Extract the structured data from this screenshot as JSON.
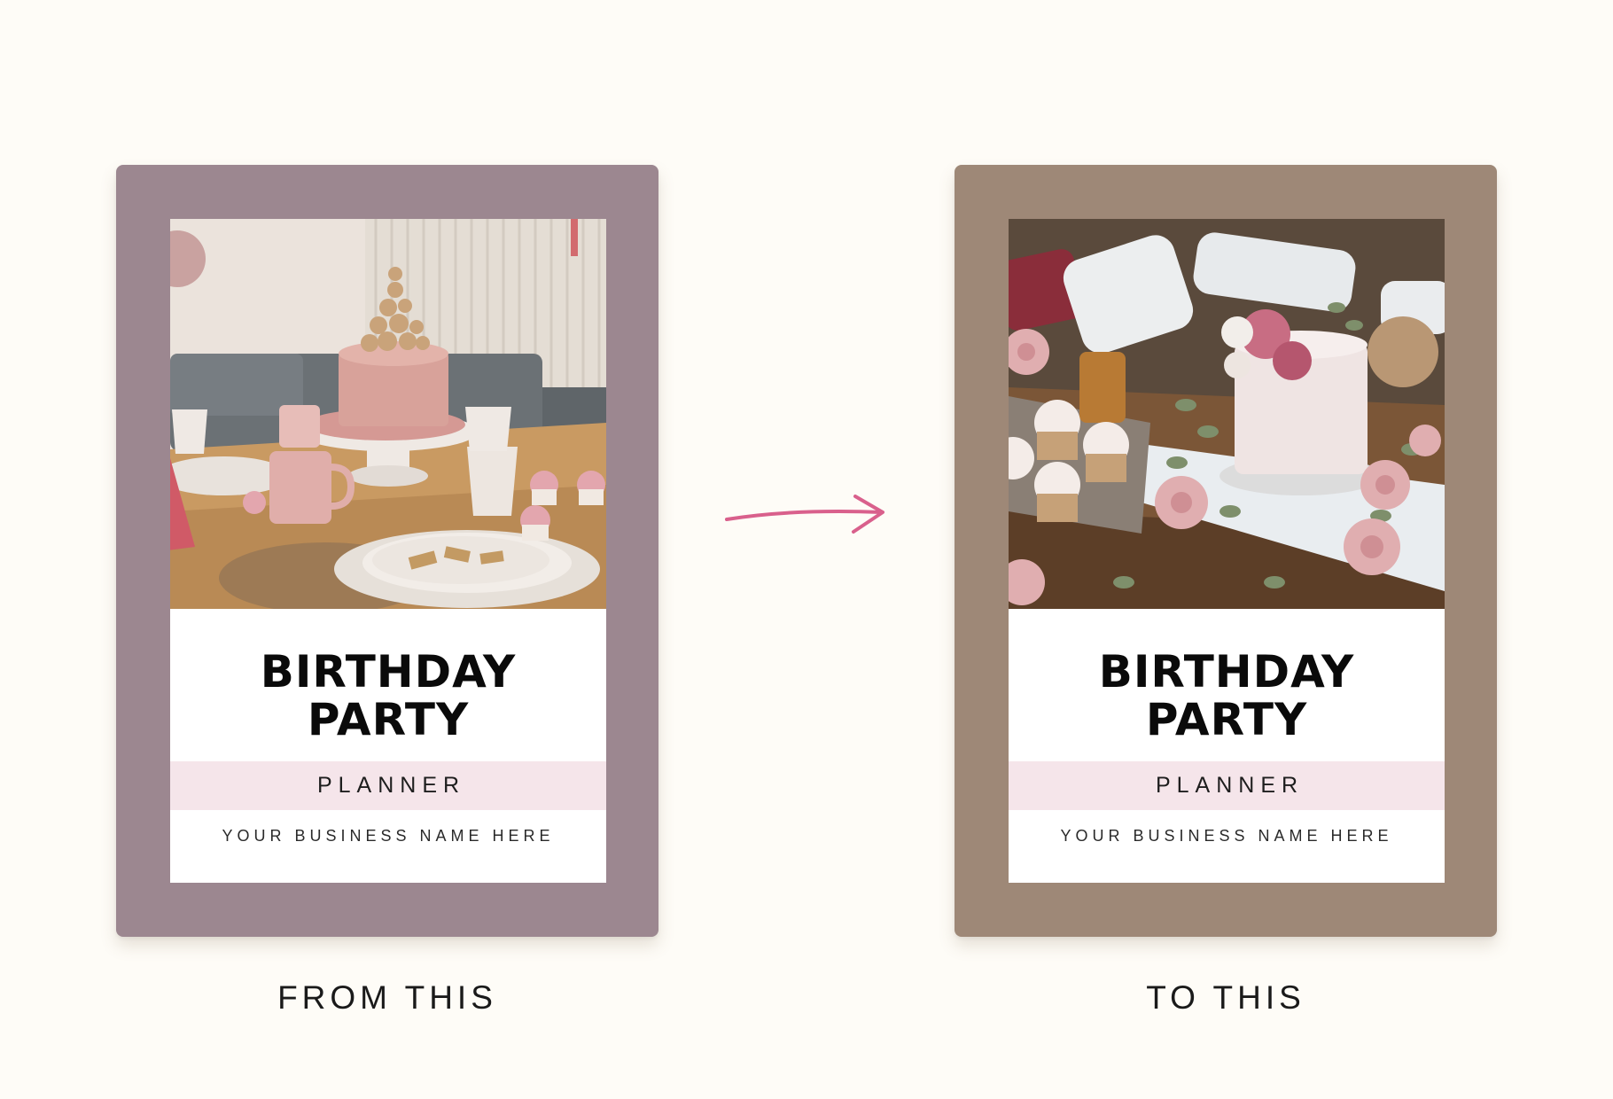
{
  "colors": {
    "page_background": "#fefcf7",
    "before_frame": "#9c8790",
    "after_frame": "#9e8877",
    "planner_band": "#f5e5ea",
    "arrow": "#d9608c"
  },
  "before": {
    "photo_description_icon": "pink-cake-table-photo",
    "title_line1": "BIRTHDAY",
    "title_line2": "PARTY",
    "subtitle": "PLANNER",
    "business": "YOUR BUSINESS NAME HERE",
    "caption": "FROM THIS"
  },
  "after": {
    "photo_description_icon": "floral-cake-picnic-photo",
    "title_line1": "BIRTHDAY",
    "title_line2": "PARTY",
    "subtitle": "PLANNER",
    "business": "YOUR BUSINESS NAME HERE",
    "caption": "TO THIS"
  },
  "arrow_icon": "right-arrow-icon"
}
